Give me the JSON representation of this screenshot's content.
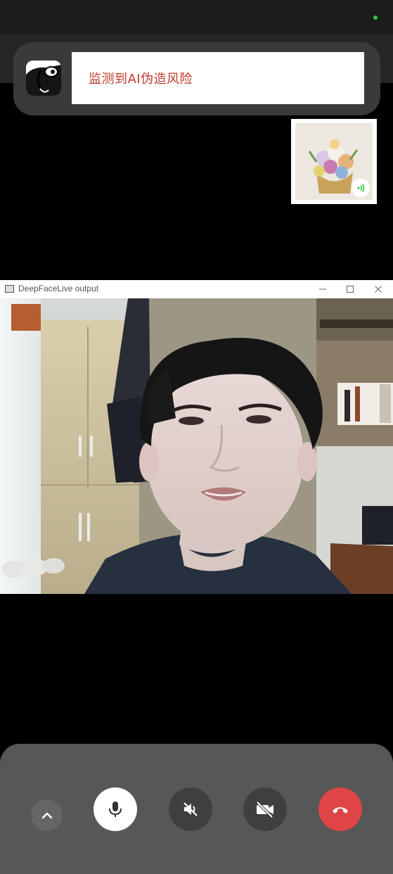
{
  "alert": {
    "message": "监测到AI伪造风险",
    "icon": "app-logo-icon",
    "text_color": "#c0392b"
  },
  "self_preview": {
    "icon": "voice-active-icon",
    "badge_color": "#2ecc40"
  },
  "video_window": {
    "title": "DeepFaceLive output",
    "buttons": [
      "minimize-icon",
      "maximize-icon",
      "close-icon"
    ]
  },
  "controls": {
    "expand": "chevron-up-icon",
    "microphone": "microphone-icon",
    "speaker": "speaker-muted-icon",
    "camera": "camera-off-icon",
    "hangup": "hang-up-icon",
    "hangup_color": "#e04545"
  }
}
